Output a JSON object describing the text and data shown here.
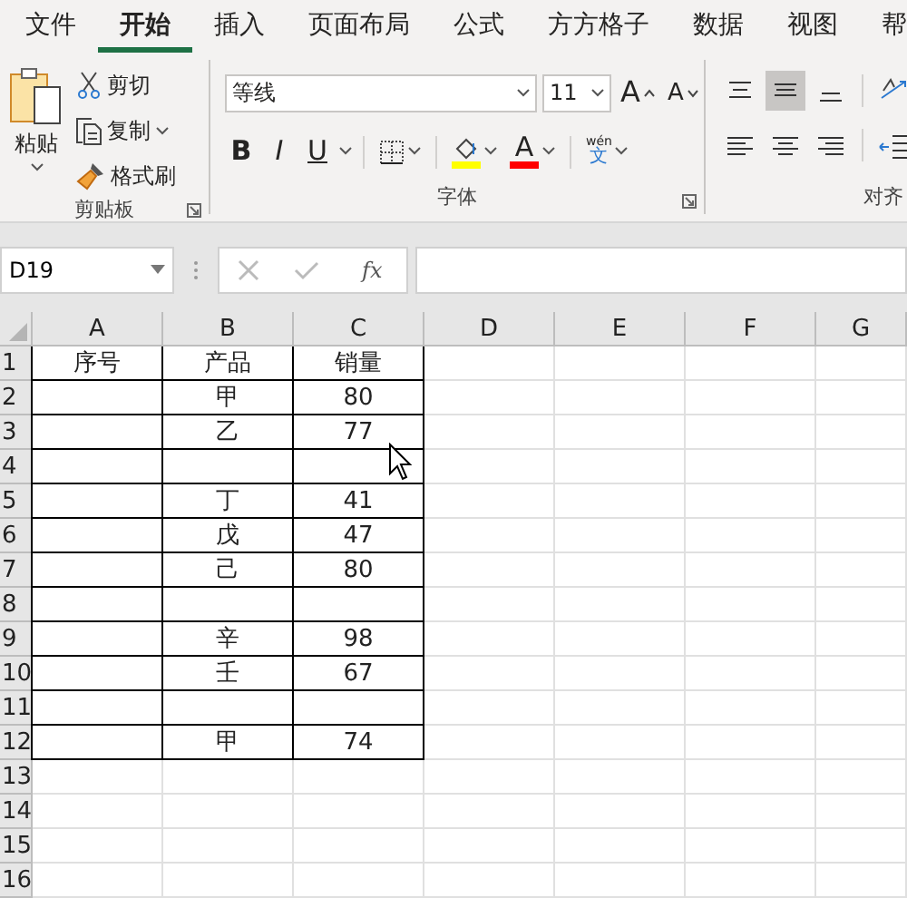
{
  "tabs": [
    {
      "label": "文件",
      "selected": false
    },
    {
      "label": "开始",
      "selected": true
    },
    {
      "label": "插入",
      "selected": false
    },
    {
      "label": "页面布局",
      "selected": false
    },
    {
      "label": "公式",
      "selected": false
    },
    {
      "label": "方方格子",
      "selected": false
    },
    {
      "label": "数据",
      "selected": false
    },
    {
      "label": "视图",
      "selected": false
    },
    {
      "label": "帮",
      "selected": false
    }
  ],
  "clipboard": {
    "label": "剪贴板",
    "paste": "粘贴",
    "cut": "剪切",
    "copy": "复制",
    "format_painter": "格式刷"
  },
  "font": {
    "label": "字体",
    "font_name": "等线",
    "font_size": "11",
    "grow": "A",
    "shrink": "A",
    "bold": "B",
    "italic": "I",
    "underline": "U",
    "font_color_letter": "A",
    "phonetic_top": "wén",
    "phonetic_bottom": "文"
  },
  "alignment": {
    "label": "对齐",
    "buttons": [
      {
        "kind": "top",
        "selected": false
      },
      {
        "kind": "middle",
        "selected": true
      },
      {
        "kind": "bottom",
        "selected": false
      },
      {
        "kind": "orientation",
        "selected": false
      },
      {
        "kind": "left",
        "selected": false
      },
      {
        "kind": "center",
        "selected": false
      },
      {
        "kind": "right",
        "selected": false
      },
      {
        "kind": "indent",
        "selected": false
      }
    ]
  },
  "formula_bar": {
    "name_box": "D19",
    "fx": "fx"
  },
  "sheet": {
    "columns": [
      "A",
      "B",
      "C",
      "D",
      "E",
      "F",
      "G"
    ],
    "rows": [
      {
        "header": "1",
        "cells": [
          {
            "text": "序号"
          },
          {
            "text": "产品"
          },
          {
            "text": "销量"
          }
        ]
      },
      {
        "header": "2",
        "cells": [
          {},
          {
            "text": "甲"
          },
          {
            "text": "80"
          }
        ]
      },
      {
        "header": "3",
        "cells": [
          {},
          {
            "text": "乙"
          },
          {
            "text": "77"
          }
        ]
      },
      {
        "header": "4",
        "cells": [
          {},
          {},
          {}
        ]
      },
      {
        "header": "5",
        "cells": [
          {},
          {
            "text": "丁"
          },
          {
            "text": "41"
          }
        ]
      },
      {
        "header": "6",
        "cells": [
          {},
          {
            "text": "戊"
          },
          {
            "text": "47"
          }
        ]
      },
      {
        "header": "7",
        "cells": [
          {},
          {
            "text": "己"
          },
          {
            "text": "80"
          }
        ]
      },
      {
        "header": "8",
        "cells": [
          {},
          {},
          {}
        ]
      },
      {
        "header": "9",
        "cells": [
          {},
          {
            "text": "辛"
          },
          {
            "text": "98"
          }
        ]
      },
      {
        "header": "10",
        "cells": [
          {},
          {
            "text": "壬"
          },
          {
            "text": "67"
          }
        ]
      },
      {
        "header": "11",
        "cells": [
          {},
          {},
          {}
        ]
      },
      {
        "header": "12",
        "cells": [
          {},
          {
            "text": "甲"
          },
          {
            "text": "74"
          }
        ]
      },
      {
        "header": "13"
      },
      {
        "header": "14"
      },
      {
        "header": "15"
      },
      {
        "header": "16"
      }
    ]
  }
}
